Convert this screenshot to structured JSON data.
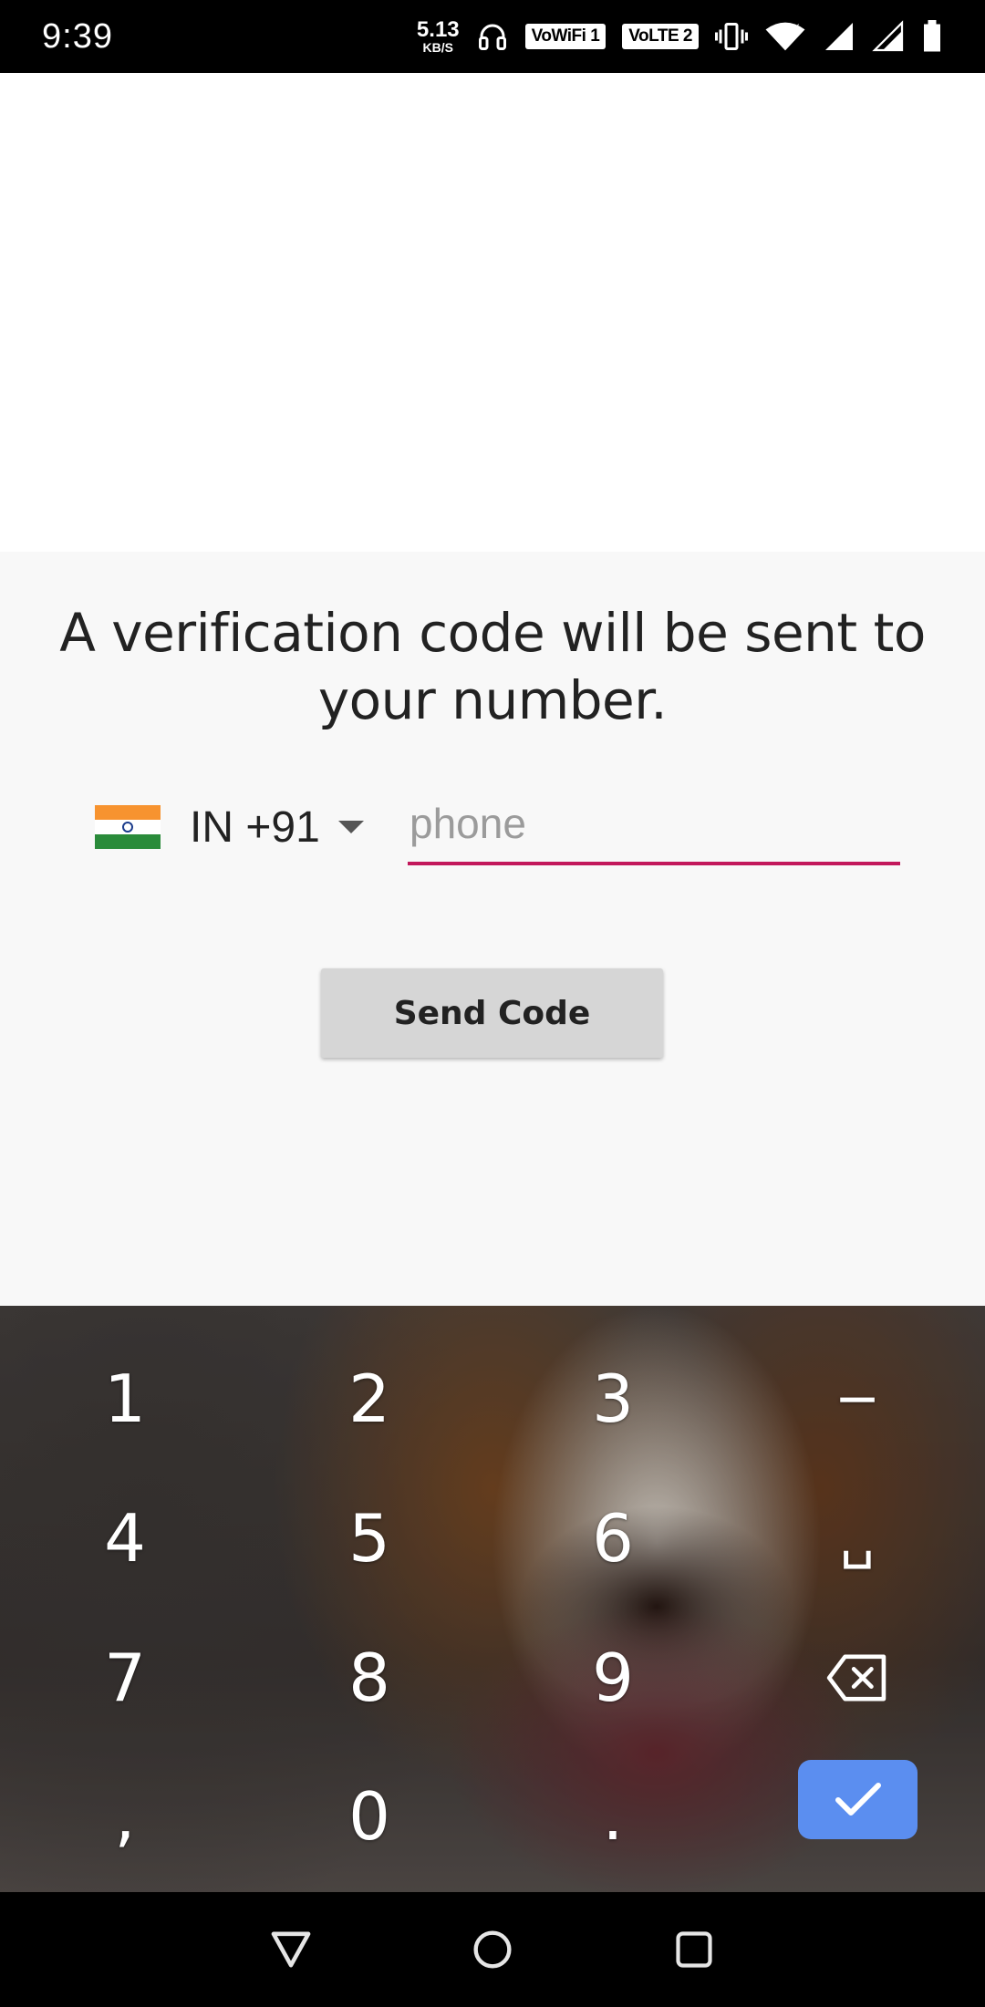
{
  "status_bar": {
    "time": "9:39",
    "net_speed_value": "5.13",
    "net_speed_unit": "KB/S",
    "wifi_badge": "VoWiFi 1",
    "lte_badge": "VoLTE 2",
    "icons": [
      "headphones-icon",
      "vibrate-icon",
      "wifi-icon",
      "signal-icon",
      "battery-icon"
    ]
  },
  "main": {
    "headline": "A verification code will be sent to your number.",
    "country": {
      "flag": "india-flag",
      "label": "IN +91"
    },
    "phone_input": {
      "value": "",
      "placeholder": "phone"
    },
    "send_button_label": "Send Code",
    "colors": {
      "input_underline": "#c2185b",
      "button_bg": "#d6d6d6",
      "enter_key": "#5b8ef0"
    }
  },
  "keyboard": {
    "keys": [
      {
        "label": "1"
      },
      {
        "label": "2"
      },
      {
        "label": "3"
      },
      {
        "label": "−"
      },
      {
        "label": "4"
      },
      {
        "label": "5"
      },
      {
        "label": "6"
      },
      {
        "label": "␣"
      },
      {
        "label": "7"
      },
      {
        "label": "8"
      },
      {
        "label": "9"
      },
      {
        "label": ""
      },
      {
        "label": ","
      },
      {
        "label": "0"
      },
      {
        "label": "."
      },
      {
        "label": ""
      }
    ],
    "icons": [
      "backspace-icon",
      "checkmark-icon"
    ]
  },
  "nav_bar": {
    "icons": [
      "back-icon",
      "home-icon",
      "recents-icon"
    ]
  }
}
